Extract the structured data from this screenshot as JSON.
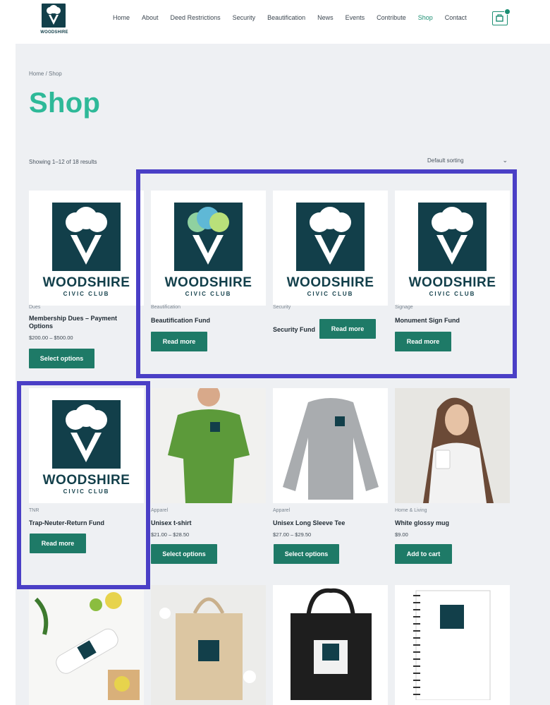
{
  "header": {
    "logo_text": "WOODSHIRE",
    "nav": [
      {
        "label": "Home"
      },
      {
        "label": "About"
      },
      {
        "label": "Deed Restrictions"
      },
      {
        "label": "Security"
      },
      {
        "label": "Beautification"
      },
      {
        "label": "News"
      },
      {
        "label": "Events"
      },
      {
        "label": "Contribute"
      },
      {
        "label": "Shop",
        "active": true
      },
      {
        "label": "Contact"
      }
    ],
    "cart_icon": "cart-icon"
  },
  "breadcrumb": "Home / Shop",
  "page_title": "Shop",
  "results_count": "Showing 1–12 of 18 results",
  "sorting": {
    "selected": "Default sorting"
  },
  "brand": {
    "title": "WOODSHIRE",
    "subtitle": "CIVIC CLUB"
  },
  "colors": {
    "accent": "#2eb998",
    "button": "#1e7a67",
    "brand_dark": "#123f4a",
    "highlight": "#4a3fc6"
  },
  "products": [
    {
      "category": "Dues",
      "name": "Membership Dues – Payment Options",
      "price": "$200.00 – $500.00",
      "button": "Select options"
    },
    {
      "category": "Beautification",
      "name": "Beautification Fund",
      "price": "",
      "button": "Read more"
    },
    {
      "category": "Security",
      "name": "Security Fund",
      "price": "",
      "button": "Read more"
    },
    {
      "category": "Signage",
      "name": "Monument Sign Fund",
      "price": "",
      "button": "Read more"
    },
    {
      "category": "TNR",
      "name": "Trap-Neuter-Return Fund",
      "price": "",
      "button": "Read more"
    },
    {
      "category": "Apparel",
      "name": "Unisex t-shirt",
      "price": "$21.00 – $28.50",
      "button": "Select options"
    },
    {
      "category": "Apparel",
      "name": "Unisex Long Sleeve Tee",
      "price": "$27.00 – $29.50",
      "button": "Select options"
    },
    {
      "category": "Home & Living",
      "name": "White glossy mug",
      "price": "$9.00",
      "button": "Add to cart"
    }
  ]
}
